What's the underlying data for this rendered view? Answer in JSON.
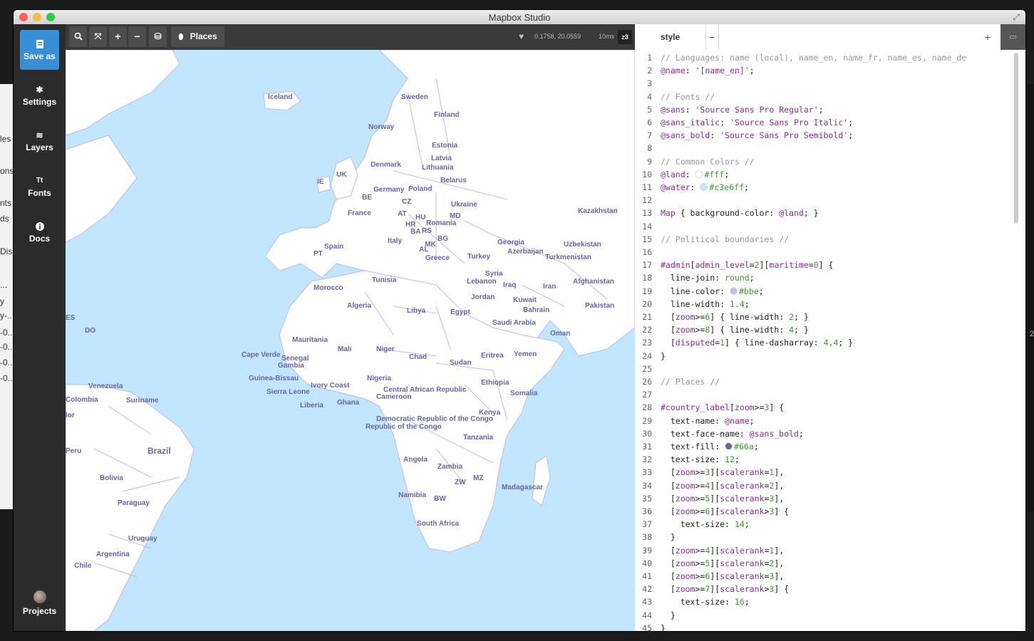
{
  "background_window": {
    "fragments": [
      "les",
      "ons",
      "nts",
      "ds",
      "Disc",
      "...",
      "y",
      "y-..",
      "-0...",
      "-0...",
      "-0...",
      "-0..."
    ],
    "right_edge": "2"
  },
  "window": {
    "title": "Mapbox Studio",
    "traffic_colors": {
      "close": "#fc605c",
      "minimize": "#fdbc40",
      "zoom": "#34c84a"
    }
  },
  "sidebar": {
    "save_as": "Save as",
    "settings": "Settings",
    "layers": "Layers",
    "fonts": "Fonts",
    "fonts_icon_text": "Tt",
    "docs": "Docs",
    "projects": "Projects",
    "accent": "#3a8fd4"
  },
  "map_toolbar": {
    "search_icon": "search-icon",
    "fit_icon": "expand-icon",
    "zoom_in": "+",
    "zoom_out": "−",
    "layers_icon": "layers-stack-icon",
    "places_label": "Places",
    "coords": "0.1758, 20.0559",
    "render_time": "10ms",
    "zoom_level": "z3"
  },
  "map": {
    "water_color": "#c3e6ff",
    "land_color": "#fff",
    "border_color": "#bbe",
    "label_color": "#66a",
    "labels": [
      "Iceland",
      "Sweden",
      "Finland",
      "Norway",
      "Estonia",
      "Latvia",
      "Lithuania",
      "Denmark",
      "UK",
      "IE",
      "Belarus",
      "Germany",
      "Poland",
      "BE",
      "CZ",
      "Ukraine",
      "France",
      "AT",
      "HU",
      "MD",
      "HR",
      "Romania",
      "BA",
      "RS",
      "Italy",
      "BG",
      "MK",
      "AL",
      "Spain",
      "PT",
      "Greece",
      "Georgia",
      "Azerbaijan",
      "Turkey",
      "Turkmenistan",
      "Uzbekistan",
      "Kazakhstan",
      "Syria",
      "Lebanon",
      "Iraq",
      "Iran",
      "Afghanistan",
      "Jordan",
      "Kuwait",
      "Bahrain",
      "Pakistan",
      "Tunisia",
      "Morocco",
      "Algeria",
      "Libya",
      "Egypt",
      "Saudi Arabia",
      "Oman",
      "Mauritania",
      "Mali",
      "Niger",
      "Chad",
      "Sudan",
      "Eritrea",
      "Yemen",
      "Senegal",
      "Gambia",
      "Cape Verde",
      "Guinea-Bissau",
      "Sierra Leone",
      "Liberia",
      "Ivory Coast",
      "Ghana",
      "Nigeria",
      "Central African Republic",
      "Cameroon",
      "Ethiopia",
      "Somalia",
      "Kenya",
      "Democratic Republic of the Congo",
      "Republic of the Congo",
      "Tanzania",
      "Angola",
      "Zambia",
      "ZW",
      "MZ",
      "Namibia",
      "BW",
      "Madagascar",
      "South Africa",
      "Venezuela",
      "Colombia",
      "Suriname",
      "Brazil",
      "Peru",
      "Bolivia",
      "Paraguay",
      "Uruguay",
      "Argentina",
      "Chile",
      "DO",
      "ES",
      "lor"
    ]
  },
  "editor": {
    "tab": "style",
    "remove": "−",
    "add": "+",
    "lines": [
      "// Languages: name (local), name_en, name_fr, name_es, name_de",
      "@name: '[name_en]';",
      "",
      "// Fonts //",
      "@sans: 'Source Sans Pro Regular';",
      "@sans_italic: 'Source Sans Pro Italic';",
      "@sans_bold: 'Source Sans Pro Semibold';",
      "",
      "// Common Colors //",
      "@land: #fff;",
      "@water: #c3e6ff;",
      "",
      "Map { background-color: @land; }",
      "",
      "// Political boundaries //",
      "",
      "#admin[admin_level=2][maritime=0] {",
      "  line-join: round;",
      "  line-color: #bbe;",
      "  line-width: 1.4;",
      "  [zoom>=6] { line-width: 2; }",
      "  [zoom>=8] { line-width: 4; }",
      "  [disputed=1] { line-dasharray: 4,4; }",
      "}",
      "",
      "// Places //",
      "",
      "#country_label[zoom>=3] {",
      "  text-name: @name;",
      "  text-face-name: @sans_bold;",
      "  text-fill: #66a;",
      "  text-size: 12;",
      "  [zoom>=3][scalerank=1],",
      "  [zoom>=4][scalerank=2],",
      "  [zoom>=5][scalerank=3],",
      "  [zoom>=6][scalerank>3] {",
      "    text-size: 14;",
      "  }",
      "  [zoom>=4][scalerank=1],",
      "  [zoom>=5][scalerank=2],",
      "  [zoom>=6][scalerank=3],",
      "  [zoom>=7][scalerank>3] {",
      "    text-size: 16;",
      "  }",
      "}"
    ],
    "swatches": {
      "land": "#fff",
      "water": "#c3e6ff",
      "border": "#bbe",
      "label": "#66a"
    }
  }
}
